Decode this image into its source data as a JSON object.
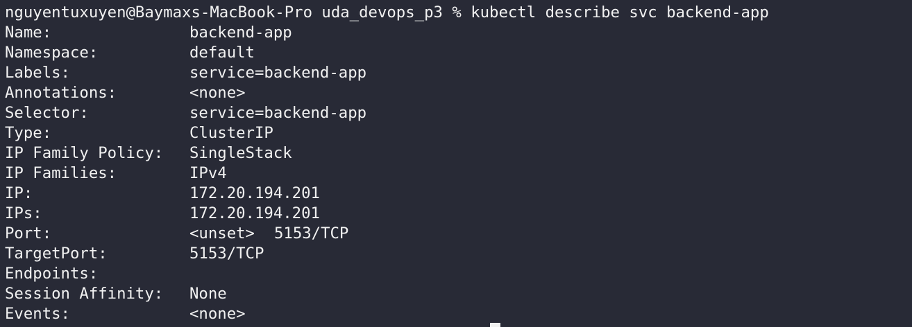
{
  "terminal": {
    "prompt_line": "nguyentuxuyen@Baymaxs-MacBook-Pro uda_devops_p3 % kubectl describe svc backend-app",
    "fields": [
      {
        "key": "Name:",
        "value": "backend-app"
      },
      {
        "key": "Namespace:",
        "value": "default"
      },
      {
        "key": "Labels:",
        "value": "service=backend-app"
      },
      {
        "key": "Annotations:",
        "value": "<none>"
      },
      {
        "key": "Selector:",
        "value": "service=backend-app"
      },
      {
        "key": "Type:",
        "value": "ClusterIP"
      },
      {
        "key": "IP Family Policy:",
        "value": "SingleStack"
      },
      {
        "key": "IP Families:",
        "value": "IPv4"
      },
      {
        "key": "IP:",
        "value": "172.20.194.201"
      },
      {
        "key": "IPs:",
        "value": "172.20.194.201"
      }
    ],
    "port": {
      "key": "Port:",
      "name": "<unset>",
      "proto": "5153/TCP"
    },
    "fields2": [
      {
        "key": "TargetPort:",
        "value": "5153/TCP"
      },
      {
        "key": "Endpoints:",
        "value": ""
      },
      {
        "key": "Session Affinity:",
        "value": "None"
      },
      {
        "key": "Events:",
        "value": "<none>"
      }
    ]
  }
}
